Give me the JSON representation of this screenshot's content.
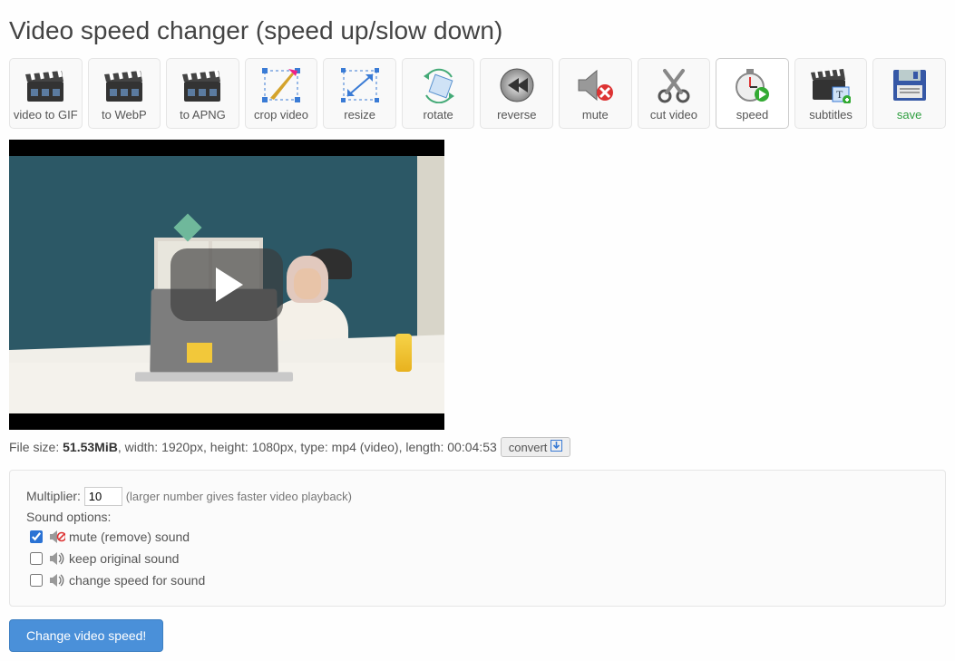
{
  "page": {
    "title": "Video speed changer (speed up/slow down)"
  },
  "toolbar": {
    "items": [
      {
        "key": "to-gif",
        "label": "video to GIF"
      },
      {
        "key": "to-webp",
        "label": "to WebP"
      },
      {
        "key": "to-apng",
        "label": "to APNG"
      },
      {
        "key": "crop",
        "label": "crop video"
      },
      {
        "key": "resize",
        "label": "resize"
      },
      {
        "key": "rotate",
        "label": "rotate"
      },
      {
        "key": "reverse",
        "label": "reverse"
      },
      {
        "key": "mute",
        "label": "mute"
      },
      {
        "key": "cut",
        "label": "cut video"
      },
      {
        "key": "speed",
        "label": "speed",
        "active": true
      },
      {
        "key": "subtitles",
        "label": "subtitles"
      },
      {
        "key": "save",
        "label": "save"
      }
    ]
  },
  "file": {
    "prefix": "File size: ",
    "size": "51.53MiB",
    "rest": ", width: 1920px, height: 1080px, type: mp4 (video), length: 00:04:53",
    "convert_label": "convert"
  },
  "form": {
    "multiplier_label": "Multiplier:",
    "multiplier_value": "10",
    "multiplier_hint": "(larger number gives faster video playback)",
    "sound_heading": "Sound options:",
    "options": [
      {
        "key": "mute",
        "label": "mute (remove) sound",
        "checked": true,
        "muted": true
      },
      {
        "key": "keep",
        "label": "keep original sound",
        "checked": false,
        "muted": false
      },
      {
        "key": "change",
        "label": "change speed for sound",
        "checked": false,
        "muted": false
      }
    ],
    "submit_label": "Change video speed!"
  }
}
